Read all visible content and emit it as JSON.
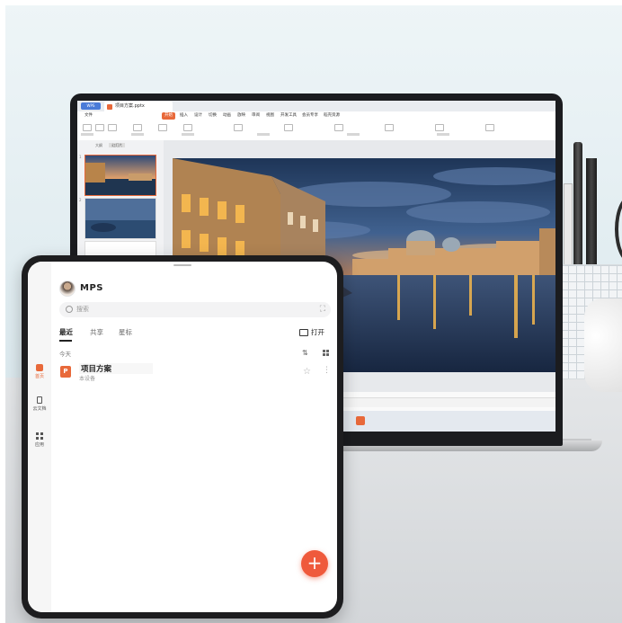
{
  "laptop": {
    "app_tab": "WPS",
    "doc_tab": "项目方案.pptx",
    "menu": [
      "文件",
      "开始",
      "插入",
      "设计",
      "切换",
      "动画",
      "放映",
      "审阅",
      "视图",
      "开发工具",
      "会员专享",
      "稻壳资源"
    ],
    "active_menu": "开始",
    "panel_tabs": [
      "大纲",
      "幻灯片"
    ],
    "thumb_numbers": [
      "1",
      "2"
    ]
  },
  "tablet": {
    "logo": "MPS",
    "search_placeholder": "搜索",
    "tabs": [
      "最近",
      "共享",
      "星标"
    ],
    "open_label": "打开",
    "section_today": "今天",
    "nav": [
      {
        "label": "首页",
        "icon": "home-icon"
      },
      {
        "label": "云文档",
        "icon": "document-icon"
      },
      {
        "label": "应用",
        "icon": "apps-grid-icon"
      }
    ],
    "file": {
      "name": "项目方案",
      "location": "本设备",
      "icon_letter": "P"
    },
    "fab_symbol": "+"
  },
  "colors": {
    "accent": "#e8693a",
    "fab": "#ef5a3c"
  }
}
